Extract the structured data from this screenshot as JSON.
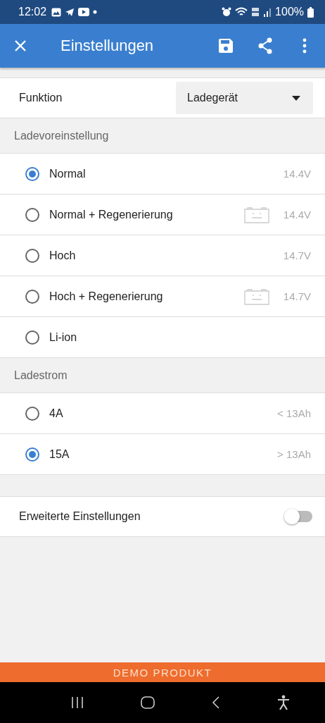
{
  "status_bar": {
    "time": "12:02",
    "battery": "100%"
  },
  "app_bar": {
    "title": "Einstellungen"
  },
  "function_row": {
    "label": "Funktion",
    "value": "Ladegerät"
  },
  "sections": [
    {
      "title": "Ladevoreinstellung",
      "options": [
        {
          "label": "Normal",
          "selected": true,
          "battery_icon": false,
          "value": "14.4V"
        },
        {
          "label": "Normal + Regenerierung",
          "selected": false,
          "battery_icon": true,
          "value": "14.4V"
        },
        {
          "label": "Hoch",
          "selected": false,
          "battery_icon": false,
          "value": "14.7V"
        },
        {
          "label": "Hoch + Regenerierung",
          "selected": false,
          "battery_icon": true,
          "value": "14.7V"
        },
        {
          "label": "Li-ion",
          "selected": false,
          "battery_icon": false
        }
      ]
    },
    {
      "title": "Ladestrom",
      "options": [
        {
          "label": "4A",
          "selected": false,
          "battery_icon": false,
          "value": "< 13Ah"
        },
        {
          "label": "15A",
          "selected": true,
          "battery_icon": false,
          "value": "> 13Ah"
        }
      ]
    }
  ],
  "advanced": {
    "label": "Erweiterte Einstellungen",
    "on": false
  },
  "demo_banner": "DEMO PRODUKT"
}
